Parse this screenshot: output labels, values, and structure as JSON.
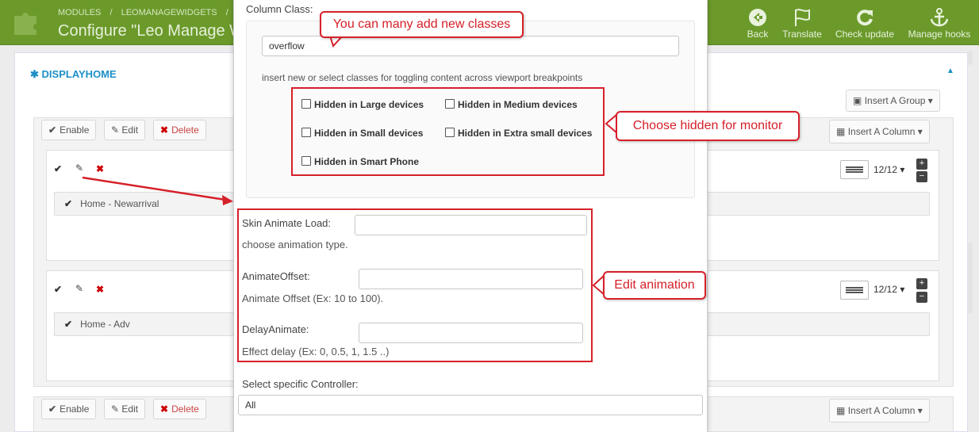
{
  "header": {
    "breadcrumb": [
      "MODULES",
      "/",
      "LEOMANAGEWIDGETS",
      "/"
    ],
    "title": "Configure \"Leo Manage W",
    "buttons": [
      {
        "label": "Back",
        "icon": "back-circle-icon"
      },
      {
        "label": "Translate",
        "icon": "flag-icon"
      },
      {
        "label": "Check update",
        "icon": "refresh-icon"
      },
      {
        "label": "Manage hooks",
        "icon": "anchor-icon"
      }
    ]
  },
  "panel": {
    "title": "DISPLAYHOME",
    "insert_group": "Insert A Group",
    "groups": [
      {
        "actions": {
          "enable": "Enable",
          "edit": "Edit",
          "delete": "Delete"
        },
        "insert_column": "Insert A Column",
        "rows": [
          {
            "widget": "Home - Newarrival",
            "size": "12/12"
          },
          {
            "widget": "Home - Adv",
            "size": "12/12"
          }
        ]
      },
      {
        "actions": {
          "enable": "Enable",
          "edit": "Edit",
          "delete": "Delete"
        },
        "insert_column": "Insert A Column"
      }
    ]
  },
  "modal": {
    "column_class_label": "Column Class:",
    "column_class_value": "overflow",
    "column_class_help": "insert new or select classes for toggling content across viewport breakpoints",
    "checkboxes": [
      "Hidden in Large devices",
      "Hidden in Medium devices",
      "Hidden in Small devices",
      "Hidden in Extra small devices",
      "Hidden in Smart Phone"
    ],
    "animate_label": "Skin Animate Load:",
    "animate_help": "choose animation type.",
    "offset_label": "AnimateOffset:",
    "offset_help": "Animate Offset (Ex: 10 to 100).",
    "delay_label": "DelayAnimate:",
    "delay_help": "Effect delay (Ex: 0, 0.5, 1, 1.5 ..)",
    "controller_label": "Select specific Controller:",
    "controller_value": "All"
  },
  "annotations": {
    "classes": "You can many add new classes",
    "hidden": "Choose hidden for monitor",
    "animation": "Edit animation"
  },
  "colors": {
    "header": "#6b9a2b",
    "accent": "#1e8fc7",
    "annotation": "#d6202a",
    "delete": "#cc0000"
  }
}
